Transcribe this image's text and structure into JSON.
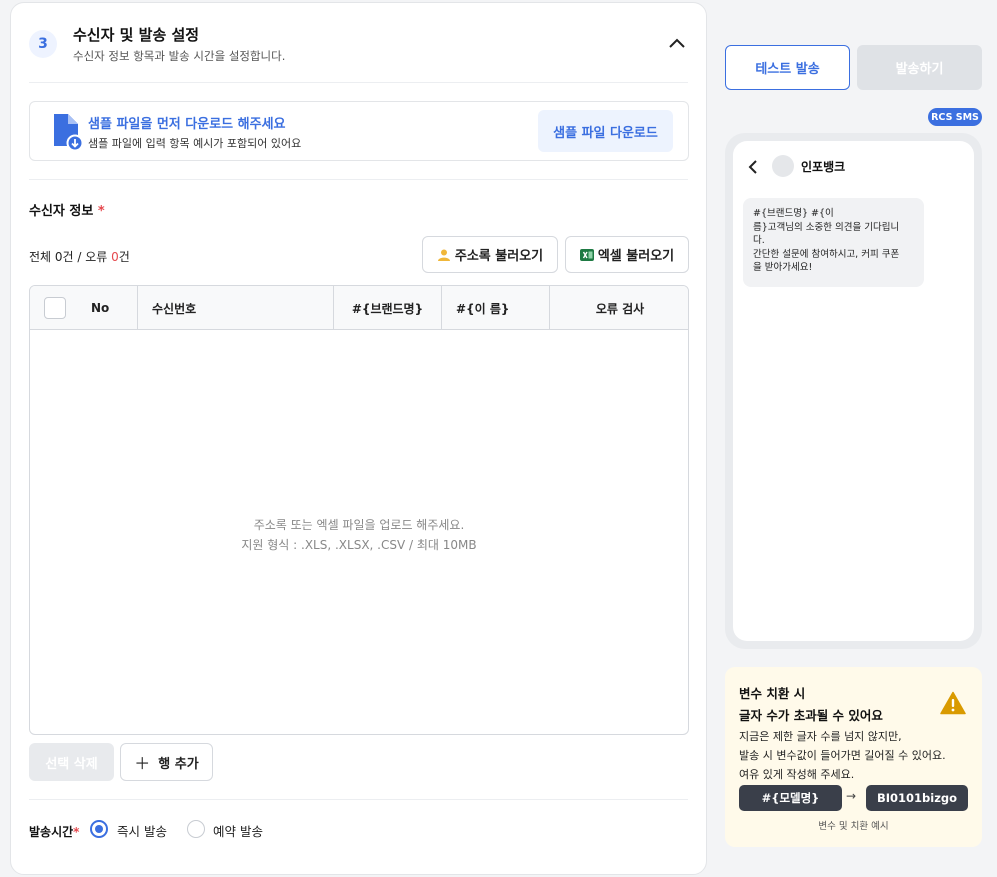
{
  "section": {
    "step": "3",
    "title": "수신자 및 발송 설정",
    "subtitle": "수신자 정보 항목과 발송 시간을 설정합니다."
  },
  "sample": {
    "title": "샘플 파일을 먼저 다운로드 해주세요",
    "subtitle": "샘플 파일에 입력 항목 예시가 포함되어 있어요",
    "button": "샘플 파일 다운로드"
  },
  "recipients": {
    "label": "수신자 정보",
    "required_mark": "*",
    "total_prefix": "전체 0건 / 오류 ",
    "error_count": "0",
    "error_suffix": "건",
    "address_button": "주소록 불러오기",
    "excel_button": "엑셀 불러오기"
  },
  "table": {
    "columns": [
      "No",
      "수신번호",
      "#{브랜드명}",
      "#{이 름}",
      "오류 검사"
    ],
    "empty_line1": "주소록 또는 엑셀 파일을 업로드 해주세요.",
    "empty_line2": "지원 형식 : .XLS, .XLSX, .CSV / 최대 10MB"
  },
  "actions": {
    "delete": "선택 삭제",
    "add_row": "행 추가"
  },
  "send_time": {
    "label": "발송시간",
    "required_mark": "*",
    "options": [
      "즉시 발송",
      "예약 발송"
    ],
    "selected": "즉시 발송"
  },
  "preview": {
    "test_button": "테스트 발송",
    "send_button": "발송하기",
    "badge": "RCS SMS",
    "sender": "인포뱅크",
    "message_lines": [
      "#{브랜드명} #{이",
      "름}고객님의 소중한 의견을 기다립니",
      "다.",
      "간단한 설문에 참여하시고, 커피 쿠폰",
      "을 받아가세요!"
    ]
  },
  "warning": {
    "title1": "변수 치환 시",
    "title2": "글자 수가 초과될 수 있어요",
    "body": [
      "지금은 제한 글자 수를 넘지 않지만,",
      "발송 시 변수값이 들어가면 길어질 수 있어요.",
      "여유 있게 작성해 주세요."
    ],
    "from": "#{모델명}",
    "to": "BI0101bizgo",
    "caption": "변수 및 치환 예시"
  },
  "colors": {
    "accent": "#3b6fe0",
    "error": "#e5484d",
    "warn_bg": "#fffaea",
    "warn_icon": "#d99a00"
  }
}
